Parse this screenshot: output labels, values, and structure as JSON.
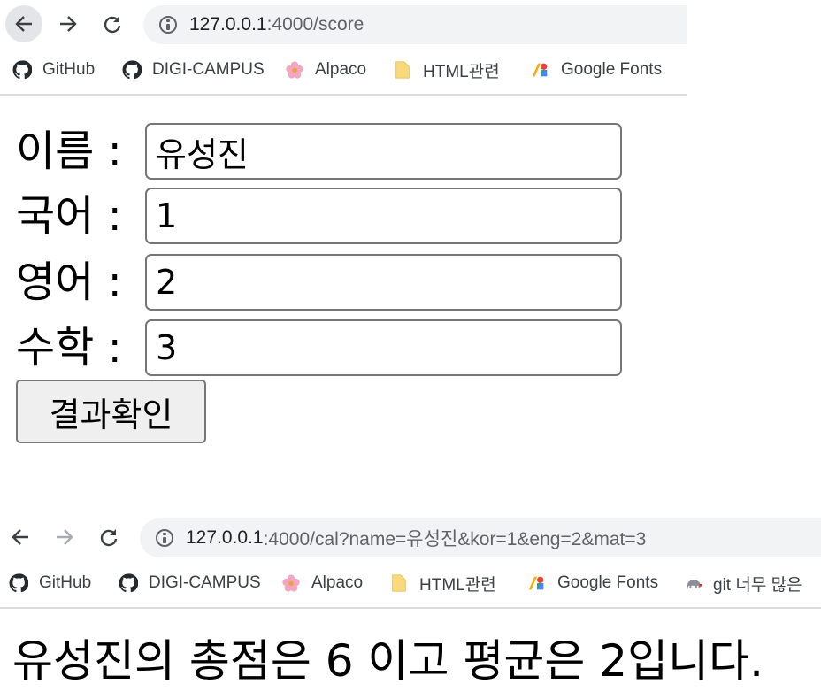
{
  "browser_top": {
    "url_host": "127.0.0.1",
    "url_path": ":4000/score",
    "bookmarks": [
      {
        "label": "GitHub",
        "icon": "github-icon"
      },
      {
        "label": "DIGI-CAMPUS",
        "icon": "github-icon"
      },
      {
        "label": "Alpaco",
        "icon": "flower-icon"
      },
      {
        "label": "HTML관련",
        "icon": "folder-icon"
      },
      {
        "label": "Google Fonts",
        "icon": "google-fonts-icon"
      }
    ]
  },
  "form": {
    "fields": [
      {
        "label": "이름 :",
        "value": "유성진"
      },
      {
        "label": "국어 :",
        "value": "1"
      },
      {
        "label": "영어 :",
        "value": "2"
      },
      {
        "label": "수학 :",
        "value": "3"
      }
    ],
    "submit_label": "결과확인"
  },
  "browser_bottom": {
    "url_host": "127.0.0.1",
    "url_path": ":4000/cal?name=유성진&kor=1&eng=2&mat=3",
    "bookmarks": [
      {
        "label": "GitHub",
        "icon": "github-icon"
      },
      {
        "label": "DIGI-CAMPUS",
        "icon": "github-icon"
      },
      {
        "label": "Alpaco",
        "icon": "flower-icon"
      },
      {
        "label": "HTML관련",
        "icon": "folder-icon"
      },
      {
        "label": "Google Fonts",
        "icon": "google-fonts-icon"
      },
      {
        "label": "git 너무 많은",
        "icon": "elephant-icon"
      }
    ]
  },
  "result": {
    "text": "유성진의 총점은 6 이고 평균은 2입니다."
  },
  "colors": {
    "omnibox_bg": "#f1f3f4",
    "folder_yellow": "#f9d97a",
    "button_bg": "#efefef",
    "input_border": "#767676"
  }
}
